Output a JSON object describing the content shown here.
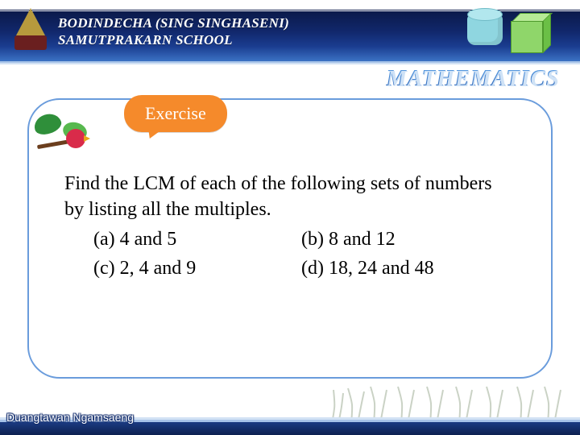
{
  "header": {
    "school_line1": "BODINDECHA  (SING SINGHASENI)",
    "school_line2": "SAMUTPRAKARN  SCHOOL",
    "subject": "MATHEMATICS"
  },
  "card": {
    "badge": "Exercise",
    "prompt": "Find the LCM of each of the  following sets of numbers by listing all the multiples.",
    "options": {
      "a": "(a)  4  and 5",
      "b": "(b)  8 and 12",
      "c": "(c)  2, 4 and 9",
      "d": "(d)  18, 24 and 48"
    }
  },
  "footer": {
    "author": "Duangtawan  Ngamsaeng"
  }
}
